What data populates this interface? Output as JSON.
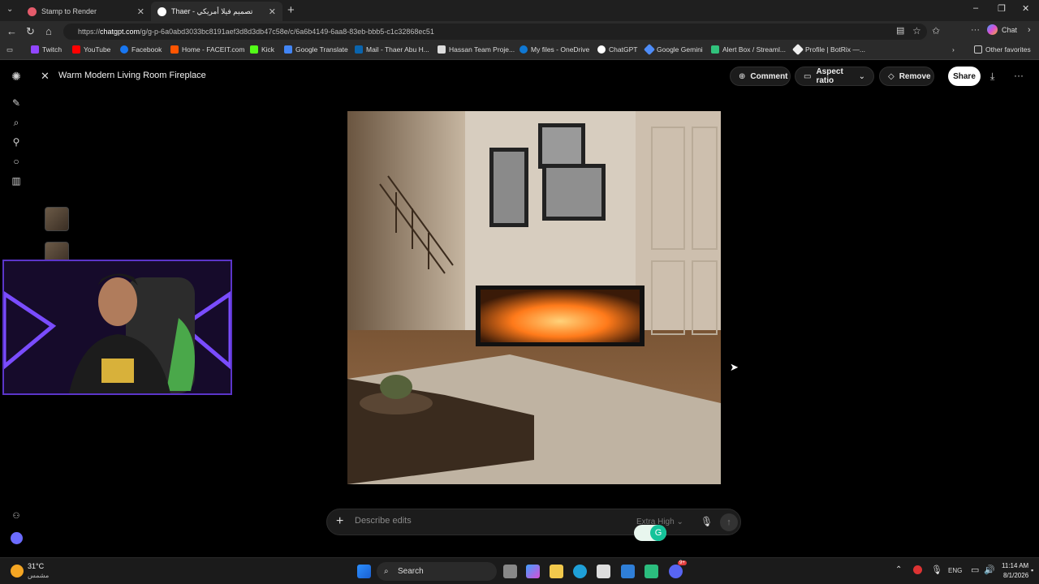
{
  "browser": {
    "tabs": [
      {
        "title": "Stamp to Render"
      },
      {
        "title": "Thaer - تصميم فيلا أمريكي"
      }
    ],
    "url_prefix": "https://",
    "url_domain": "chatgpt.com",
    "url_rest": "/g/g-p-6a0abd3033bc8191aef3d8d3db47c58e/c/6a6b4149-6aa8-83eb-bbb5-c1c32868ec51",
    "chat_button": "Chat",
    "bookmarks": [
      "Twitch",
      "YouTube",
      "Facebook",
      "Home - FACEIT.com",
      "Kick",
      "Google Translate",
      "Mail - Thaer Abu H...",
      "Hassan Team Proje...",
      "My files - OneDrive",
      "ChatGPT",
      "Google Gemini",
      "Alert Box / Streaml...",
      "Profile | BotRix —..."
    ],
    "other_favorites": "Other favorites"
  },
  "viewer": {
    "title": "Warm Modern Living Room Fireplace",
    "comment": "Comment",
    "aspect_ratio": "Aspect ratio",
    "remove": "Remove",
    "share": "Share",
    "prompt_placeholder": "Describe edits",
    "quality": "Extra High"
  },
  "taskbar": {
    "weather_temp": "31°C",
    "weather_desc": "مشمس",
    "search": "Search",
    "lang": "ENG",
    "time": "11:14 AM",
    "date": "8/1/2026",
    "discord_badge": "9+"
  },
  "colors": {
    "accent": "#5b35c9",
    "taskbar": "#1b1b1b"
  }
}
